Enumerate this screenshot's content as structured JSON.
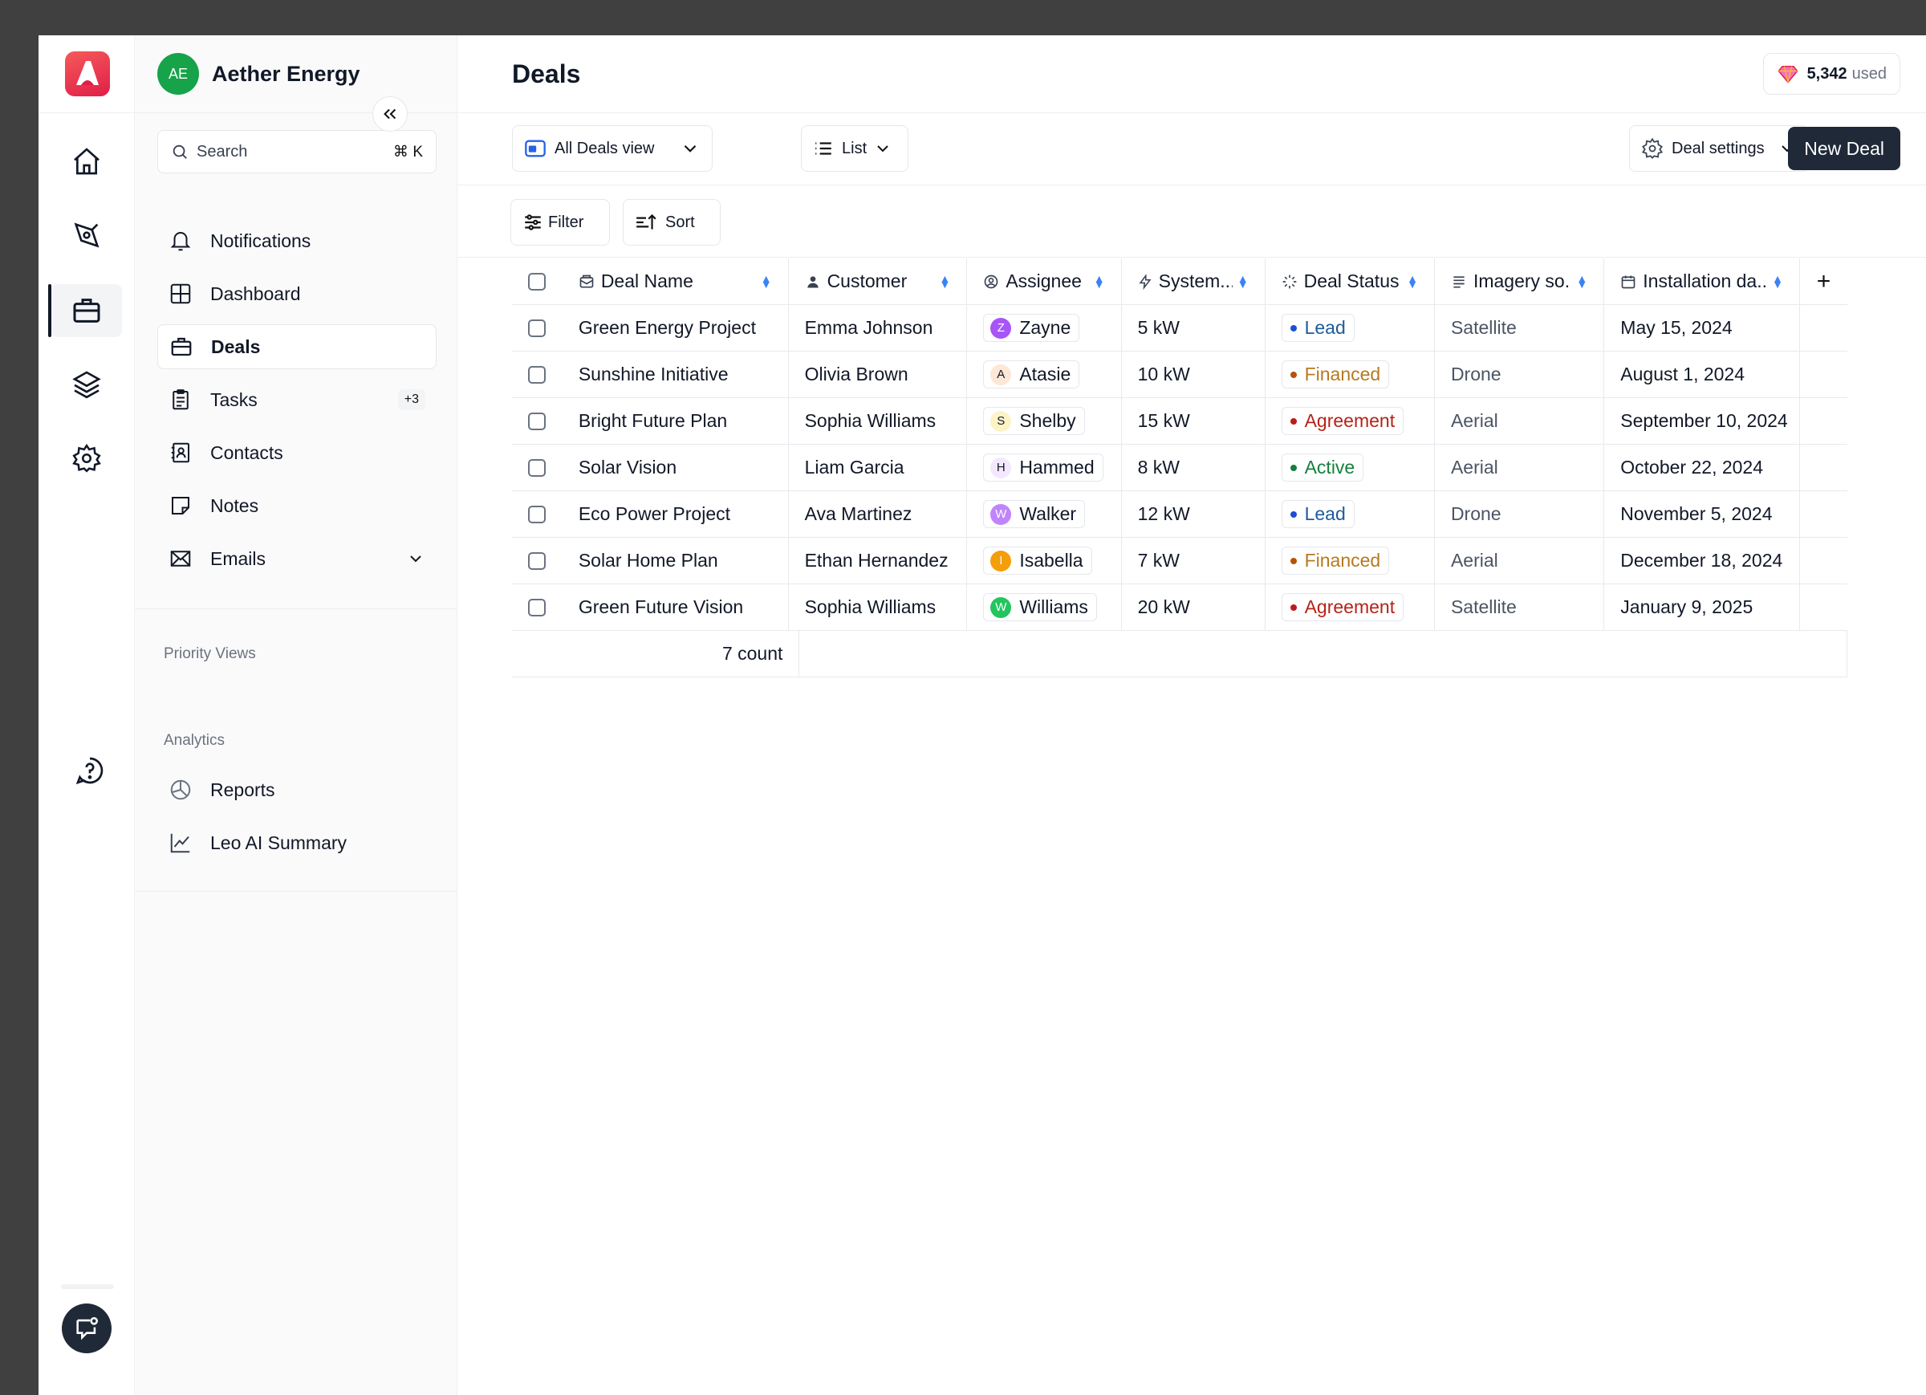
{
  "workspace": {
    "initials": "AE",
    "name": "Aether Energy"
  },
  "search": {
    "label": "Search",
    "shortcut": "⌘ K"
  },
  "nav": {
    "items": [
      {
        "label": "Notifications",
        "icon": "bell-icon"
      },
      {
        "label": "Dashboard",
        "icon": "grid-icon"
      },
      {
        "label": "Deals",
        "icon": "briefcase-icon",
        "active": true
      },
      {
        "label": "Tasks",
        "icon": "clipboard-icon",
        "badge": "+3"
      },
      {
        "label": "Contacts",
        "icon": "contact-icon"
      },
      {
        "label": "Notes",
        "icon": "note-icon"
      },
      {
        "label": "Emails",
        "icon": "mail-icon"
      }
    ],
    "priority_views_title": "Priority Views",
    "analytics_title": "Analytics",
    "analytics_items": [
      {
        "label": "Reports",
        "icon": "pie-chart-icon"
      },
      {
        "label": "Leo AI Summary",
        "icon": "line-chart-icon"
      }
    ]
  },
  "header": {
    "title": "Deals",
    "credits_value": "5,342",
    "credits_suffix": "used"
  },
  "toolbar": {
    "view_label": "All Deals view",
    "layout_label": "List",
    "settings_label": "Deal settings",
    "new_deal_label": "New Deal",
    "filter_label": "Filter",
    "sort_label": "Sort"
  },
  "table": {
    "columns": [
      "Deal Name",
      "Customer",
      "Assignee",
      "System...",
      "Deal Status",
      "Imagery so...",
      "Installation da.."
    ],
    "rows": [
      {
        "deal": "Green Energy Project",
        "customer": "Emma Johnson",
        "assignee": "Zayne",
        "initial": "Z",
        "system": "5 kW",
        "status": "Lead",
        "imagery": "Satellite",
        "date": "May 15, 2024"
      },
      {
        "deal": "Sunshine Initiative",
        "customer": "Olivia Brown",
        "assignee": "Atasie",
        "initial": "A",
        "system": "10 kW",
        "status": "Financed",
        "imagery": "Drone",
        "date": "August 1, 2024"
      },
      {
        "deal": "Bright Future Plan",
        "customer": "Sophia Williams",
        "assignee": "Shelby",
        "initial": "S",
        "system": "15 kW",
        "status": "Agreement",
        "imagery": "Aerial",
        "date": "September 10, 2024"
      },
      {
        "deal": "Solar Vision",
        "customer": "Liam Garcia",
        "assignee": "Hammed",
        "initial": "H",
        "system": "8 kW",
        "status": "Active",
        "imagery": "Aerial",
        "date": "October 22, 2024"
      },
      {
        "deal": "Eco Power Project",
        "customer": "Ava Martinez",
        "assignee": "Walker",
        "initial": "W",
        "system": "12 kW",
        "status": "Lead",
        "imagery": "Drone",
        "date": "November 5, 2024"
      },
      {
        "deal": "Solar Home Plan",
        "customer": "Ethan Hernandez",
        "assignee": "Isabella",
        "initial": "I",
        "system": "7 kW",
        "status": "Financed",
        "imagery": "Aerial",
        "date": "December 18, 2024"
      },
      {
        "deal": "Green Future Vision",
        "customer": "Sophia Williams",
        "assignee": "Williams",
        "initial": "W",
        "system": "20 kW",
        "status": "Agreement",
        "imagery": "Satellite",
        "date": "January 9, 2025"
      }
    ],
    "count_label": "7 count"
  },
  "colors": {
    "status": {
      "Lead": "#1d4ed8",
      "Financed": "#b45309",
      "Agreement": "#b91c1c",
      "Active": "#15803d"
    },
    "status_text": {
      "Lead": "#1e5a9a",
      "Financed": "#b7791f",
      "Agreement": "#b42318",
      "Active": "#15803d"
    },
    "avatar_bg": {
      "Zayne": "#a855f7",
      "Atasie": "#fde7d6",
      "Shelby": "#fef3c7",
      "Hammed": "#f3e8ff",
      "Walker": "#c084fc",
      "Isabella": "#f59e0b",
      "Williams": "#22c55e"
    },
    "avatar_fg": {
      "Zayne": "#ffffff",
      "Atasie": "#111827",
      "Shelby": "#111827",
      "Hammed": "#111827",
      "Walker": "#ffffff",
      "Isabella": "#ffffff",
      "Williams": "#ffffff"
    }
  }
}
